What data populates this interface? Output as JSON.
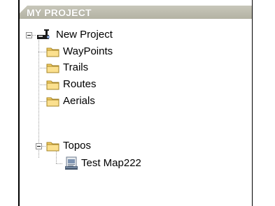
{
  "panel": {
    "title": "MY PROJECT"
  },
  "tree": {
    "root": {
      "label": "New Project",
      "icon": "project-globe-icon",
      "expanded": true,
      "children": [
        {
          "label": "WayPoints",
          "icon": "folder-icon"
        },
        {
          "label": "Trails",
          "icon": "folder-icon"
        },
        {
          "label": "Routes",
          "icon": "folder-icon"
        },
        {
          "label": "Aerials",
          "icon": "folder-icon"
        },
        {
          "label": "Topos",
          "icon": "folder-icon",
          "expanded": true,
          "children": [
            {
              "label": "Test Map222",
              "icon": "map-document-icon"
            }
          ]
        }
      ]
    }
  },
  "colors": {
    "header_background": "#b8b7a8",
    "header_text": "#ffffff",
    "folder_fill": "#f7d36d",
    "tree_line": "#9c9c9c"
  }
}
